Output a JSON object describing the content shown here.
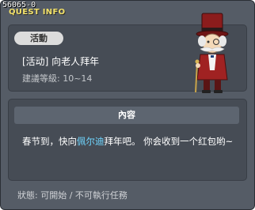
{
  "window": {
    "id_label": "56065-0",
    "title": "QUEST INFO"
  },
  "quest": {
    "badge": "活動",
    "name": "[活动] 向老人拜年",
    "level": "建議等級: 10~14",
    "npc_icon": "old-gentleman-npc"
  },
  "content": {
    "header": "內容",
    "text_before": "春节到，快向",
    "npc_name": "佩尔迪",
    "text_after": "拜年吧。 你会收到一个红包哟~"
  },
  "status": "狀態: 可開始 / 不可執行任務",
  "colors": {
    "title": "#f3e26a",
    "npc_highlight": "#6fd6ff",
    "panel": "#464c55",
    "window": "#555c66"
  }
}
